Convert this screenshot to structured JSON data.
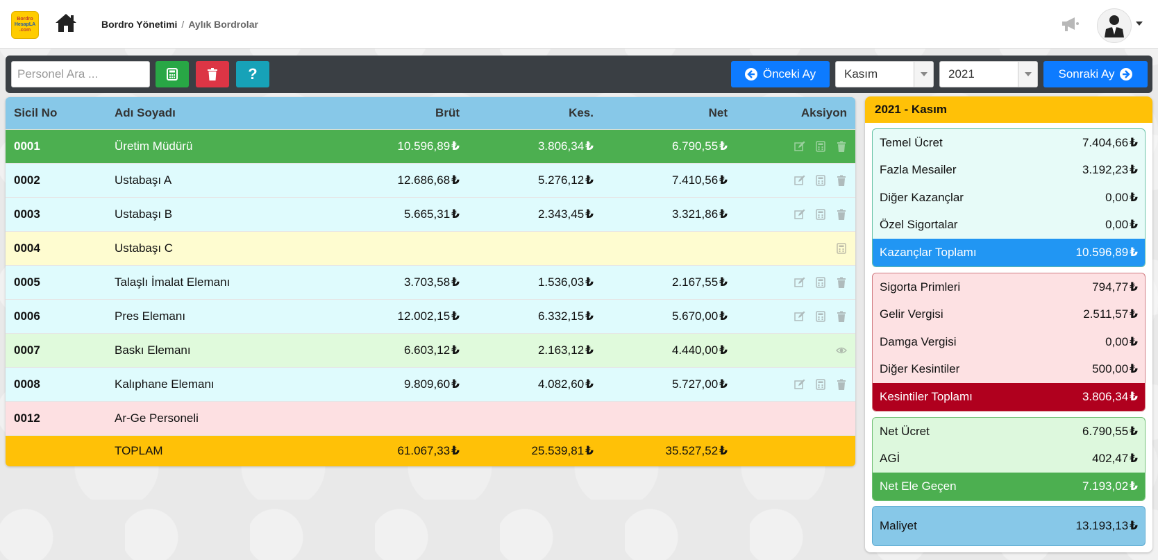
{
  "header": {
    "logo_line1": "Bordro",
    "logo_line2": "HesapLA",
    "logo_line3": ".com",
    "breadcrumb_root": "Bordro Yönetimi",
    "breadcrumb_sep": "/",
    "breadcrumb_current": "Aylık Bordrolar"
  },
  "toolbar": {
    "search_placeholder": "Personel Ara ...",
    "help_label": "?",
    "prev_label": "Önceki Ay",
    "next_label": "Sonraki Ay",
    "month_value": "Kasım",
    "year_value": "2021"
  },
  "table": {
    "columns": [
      "Sicil No",
      "Adı Soyadı",
      "Brüt",
      "Kes.",
      "Net",
      "Aksiyon"
    ],
    "currency": "₺",
    "rows": [
      {
        "sicil": "0001",
        "name": "Üretim Müdürü",
        "brut": "10.596,89",
        "kes": "3.806,34",
        "net": "6.790,55",
        "bg": "#4caf50",
        "fg": "#ffffff",
        "actions": [
          "edit",
          "calc",
          "delete"
        ]
      },
      {
        "sicil": "0002",
        "name": "Ustabaşı A",
        "brut": "12.686,68",
        "kes": "5.276,12",
        "net": "7.410,56",
        "bg": "#dffbfd",
        "fg": "#111111",
        "actions": [
          "edit",
          "calc",
          "delete"
        ]
      },
      {
        "sicil": "0003",
        "name": "Ustabaşı B",
        "brut": "5.665,31",
        "kes": "2.343,45",
        "net": "3.321,86",
        "bg": "#dffbfd",
        "fg": "#111111",
        "actions": [
          "edit",
          "calc",
          "delete"
        ]
      },
      {
        "sicil": "0004",
        "name": "Ustabaşı C",
        "brut": "",
        "kes": "",
        "net": "",
        "bg": "#fefcd0",
        "fg": "#111111",
        "actions": [
          "calc"
        ]
      },
      {
        "sicil": "0005",
        "name": "Talaşlı İmalat Elemanı",
        "brut": "3.703,58",
        "kes": "1.536,03",
        "net": "2.167,55",
        "bg": "#dffbfd",
        "fg": "#111111",
        "actions": [
          "edit",
          "calc",
          "delete"
        ]
      },
      {
        "sicil": "0006",
        "name": "Pres Elemanı",
        "brut": "12.002,15",
        "kes": "6.332,15",
        "net": "5.670,00",
        "bg": "#dffbfd",
        "fg": "#111111",
        "actions": [
          "edit",
          "calc",
          "delete"
        ]
      },
      {
        "sicil": "0007",
        "name": "Baskı Elemanı",
        "brut": "6.603,12",
        "kes": "2.163,12",
        "net": "4.440,00",
        "bg": "#e0fadc",
        "fg": "#111111",
        "actions": [
          "view"
        ]
      },
      {
        "sicil": "0008",
        "name": "Kalıphane Elemanı",
        "brut": "9.809,60",
        "kes": "4.082,60",
        "net": "5.727,00",
        "bg": "#dffbfd",
        "fg": "#111111",
        "actions": [
          "edit",
          "calc",
          "delete"
        ]
      },
      {
        "sicil": "0012",
        "name": "Ar-Ge Personeli",
        "brut": "",
        "kes": "",
        "net": "",
        "bg": "#fde0e2",
        "fg": "#111111",
        "actions": []
      }
    ],
    "total": {
      "label": "TOPLAM",
      "brut": "61.067,33",
      "kes": "25.539,81",
      "net": "35.527,52"
    }
  },
  "summary": {
    "title": "2021 - Kasım",
    "earnings": [
      {
        "label": "Temel Ücret",
        "value": "7.404,66"
      },
      {
        "label": "Fazla Mesailer",
        "value": "3.192,23"
      },
      {
        "label": "Diğer Kazançlar",
        "value": "0,00"
      },
      {
        "label": "Özel Sigortalar",
        "value": "0,00"
      }
    ],
    "earnings_total": {
      "label": "Kazançlar Toplamı",
      "value": "10.596,89"
    },
    "deductions": [
      {
        "label": "Sigorta Primleri",
        "value": "794,77"
      },
      {
        "label": "Gelir Vergisi",
        "value": "2.511,57"
      },
      {
        "label": "Damga Vergisi",
        "value": "0,00"
      },
      {
        "label": "Diğer Kesintiler",
        "value": "500,00"
      }
    ],
    "deductions_total": {
      "label": "Kesintiler Toplamı",
      "value": "3.806,34"
    },
    "net": [
      {
        "label": "Net Ücret",
        "value": "6.790,55"
      },
      {
        "label": "AGİ",
        "value": "402,47"
      }
    ],
    "net_total": {
      "label": "Net Ele Geçen",
      "value": "7.193,02"
    },
    "cost": {
      "label": "Maliyet",
      "value": "13.193,13"
    }
  }
}
